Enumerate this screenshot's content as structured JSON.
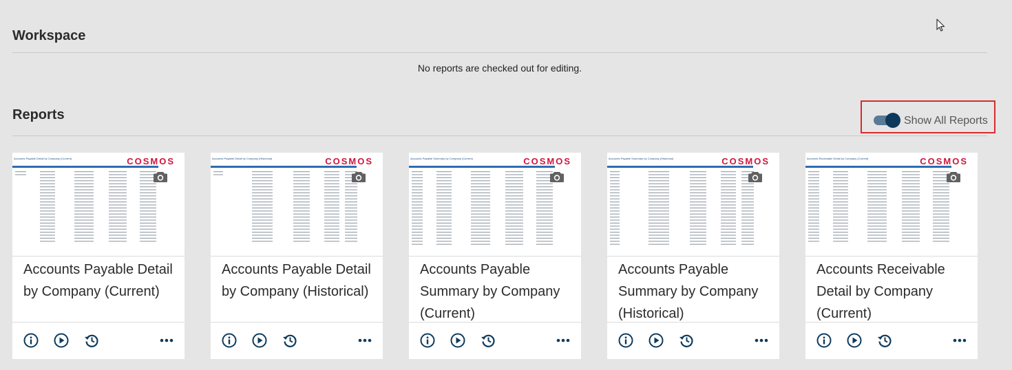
{
  "workspace": {
    "title": "Workspace",
    "empty_message": "No reports are checked out for editing."
  },
  "reports": {
    "title": "Reports",
    "toggle": {
      "label": "Show All Reports",
      "on": true
    },
    "cards": [
      {
        "title": "Accounts Payable Detail by Company (Current)",
        "thumb_title": "Accounts Payable Detail by Company (Current)",
        "logo": "COSMOS"
      },
      {
        "title": "Accounts Payable Detail by Company (Historical)",
        "thumb_title": "Accounts Payable Detail by Company (Historical)",
        "logo": "COSMOS"
      },
      {
        "title": "Accounts Payable Summary by Company (Current)",
        "thumb_title": "Accounts Payable Summary by Company (Current)",
        "logo": "COSMOS"
      },
      {
        "title": "Accounts Payable Summary by Company (Historical)",
        "thumb_title": "Accounts Payable Summary by Company (Historical)",
        "logo": "COSMOS"
      },
      {
        "title": "Accounts Receivable Detail by Company (Current)",
        "thumb_title": "Accounts Receivable Detail by Company (Current)",
        "logo": "COSMOS"
      }
    ]
  },
  "icons": {
    "info": "info-circle-icon",
    "run": "play-circle-icon",
    "history": "history-icon",
    "more": "more-horizontal-icon",
    "snapshot": "camera-icon",
    "cursor": "mouse-pointer-icon"
  },
  "colors": {
    "background": "#e5e5e5",
    "accent": "#0d3a5c",
    "highlight_border": "#d62b2b",
    "logo": "#d0143d",
    "thumb_header_bar": "#2c6cb0"
  }
}
